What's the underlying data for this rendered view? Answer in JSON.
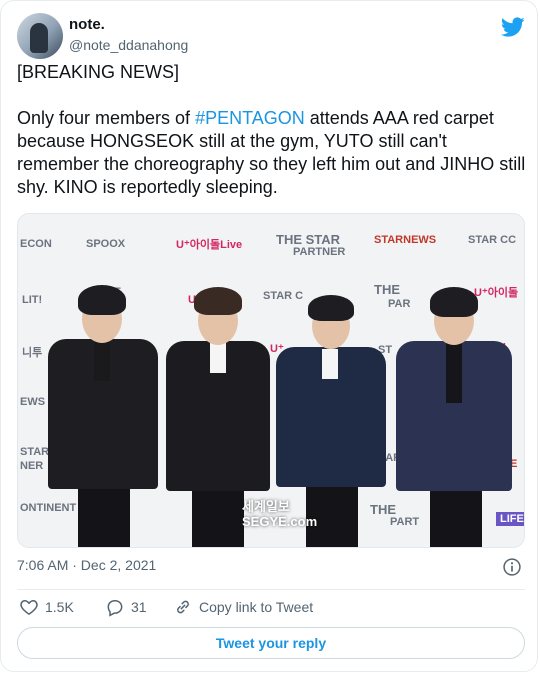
{
  "user": {
    "display_name": "note.",
    "handle": "@note_ddanahong"
  },
  "tweet": {
    "line1": "[BREAKING NEWS]",
    "before_hashtag": "Only four members of ",
    "hashtag": "#PENTAGON",
    "after_hashtag": " attends AAA red carpet because HONGSEOK still at the gym, YUTO still can't remember the choreography so they left him out and JINHO still shy. KINO is reportedly sleeping."
  },
  "photo": {
    "backdrop_logos": [
      "ECON",
      "SPOOX",
      "U⁺아이돌Live",
      "THE STAR",
      "PARTNER",
      "STARNEWS",
      "STAR CC",
      "LIT!",
      "T",
      "U",
      "STAR C",
      "THE",
      "PAR",
      "U⁺아이돌",
      "니투",
      "U⁺",
      "ST",
      "aul",
      "EWS",
      "SPO",
      "STAR",
      "NER",
      "S",
      "STAR",
      "RE",
      "ONTINENT",
      "THE",
      "PART",
      "LIFE WO"
    ],
    "watermark_line1": "세계일보",
    "watermark_line2": "SEGYE.com"
  },
  "meta": {
    "timestamp": "7:06 AM · Dec 2, 2021"
  },
  "actions": {
    "likes": "1.5K",
    "replies": "31",
    "copy_link": "Copy link to Tweet"
  },
  "reply_button": "Tweet your reply",
  "colors": {
    "accent": "#1b95e0",
    "twitter_blue": "#1da1f2",
    "secondary_text": "#536471"
  }
}
